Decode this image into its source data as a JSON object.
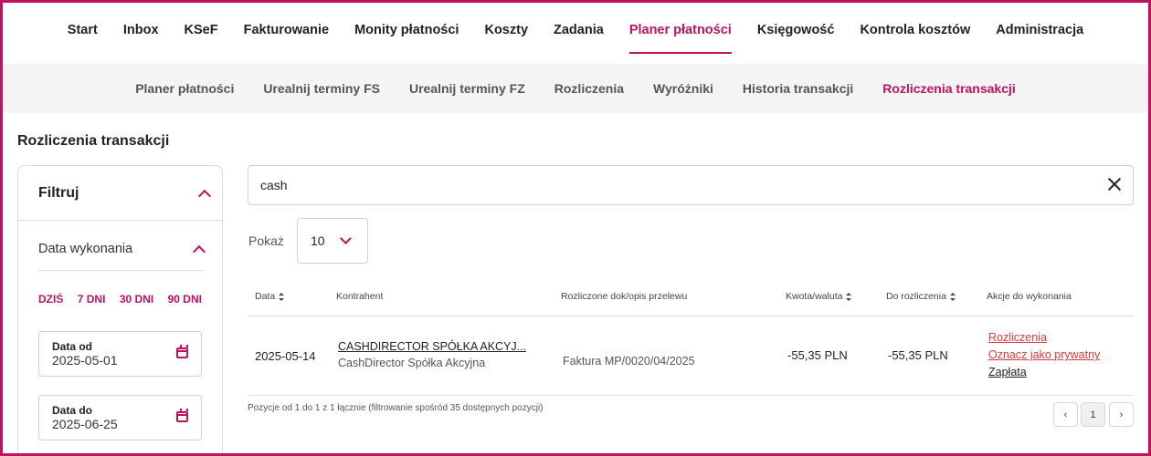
{
  "topnav": {
    "items": [
      {
        "label": "Start"
      },
      {
        "label": "Inbox"
      },
      {
        "label": "KSeF"
      },
      {
        "label": "Fakturowanie"
      },
      {
        "label": "Monity płatności"
      },
      {
        "label": "Koszty"
      },
      {
        "label": "Zadania"
      },
      {
        "label": "Planer płatności",
        "active": true
      },
      {
        "label": "Księgowość"
      },
      {
        "label": "Kontrola kosztów"
      },
      {
        "label": "Administracja"
      }
    ]
  },
  "subnav": {
    "items": [
      {
        "label": "Planer płatności"
      },
      {
        "label": "Urealnij terminy FS"
      },
      {
        "label": "Urealnij terminy FZ"
      },
      {
        "label": "Rozliczenia"
      },
      {
        "label": "Wyróżniki"
      },
      {
        "label": "Historia transakcji"
      },
      {
        "label": "Rozliczenia transakcji",
        "active": true
      }
    ]
  },
  "page": {
    "title": "Rozliczenia transakcji"
  },
  "filter": {
    "title": "Filtruj",
    "section_title": "Data wykonania",
    "quick": [
      "DZIŚ",
      "7 DNI",
      "30 DNI",
      "90 DNI"
    ],
    "date_from": {
      "label": "Data od",
      "value": "2025-05-01"
    },
    "date_to": {
      "label": "Data do",
      "value": "2025-06-25"
    }
  },
  "search": {
    "value": "cash"
  },
  "page_size": {
    "label": "Pokaż",
    "value": "10"
  },
  "table": {
    "headers": {
      "date": "Data",
      "contractor": "Kontrahent",
      "docs": "Rozliczone dok/opis przelewu",
      "amount": "Kwota/waluta",
      "to_settle": "Do rozliczenia",
      "actions": "Akcje do wykonania"
    },
    "rows": [
      {
        "date": "2025-05-14",
        "contractor_link": "CASHDIRECTOR SPÓŁKA AKCYJ...",
        "contractor_name": "CashDirector Spółka Akcyjna",
        "doc": "Faktura MP/0020/04/2025",
        "amount": "-55,35 PLN",
        "to_settle": "-55,35 PLN",
        "actions": [
          "Rozliczenia",
          "Oznacz jako prywatny",
          "Zapłata"
        ]
      }
    ]
  },
  "footer": {
    "info": "Pozycje od 1 do 1 z 1 łącznie (filtrowanie spośród 35 dostępnych pozycji)",
    "pager": {
      "prev": "‹",
      "current": "1",
      "next": "›"
    }
  },
  "colors": {
    "accent": "#c0125f",
    "action_red": "#e03a3a"
  }
}
